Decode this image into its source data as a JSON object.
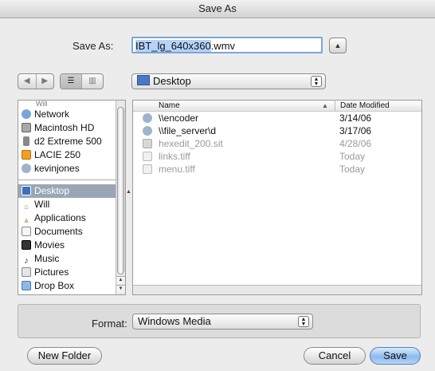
{
  "window": {
    "title": "Save As"
  },
  "save_as": {
    "label": "Save As:",
    "filename": "IBT_lg_640x360.wmv",
    "filename_selected": "IBT_lg_640x360",
    "filename_ext": ".wmv"
  },
  "nav": {
    "location": "Desktop"
  },
  "sidebar": {
    "partial_top": "Will",
    "devices": [
      {
        "label": "Network",
        "icon": "network-globe-icon"
      },
      {
        "label": "Macintosh HD",
        "icon": "hard-drive-icon"
      },
      {
        "label": "d2 Extreme 500",
        "icon": "external-drive-icon"
      },
      {
        "label": "LACIE 250",
        "icon": "external-drive-orange-icon"
      },
      {
        "label": "kevinjones",
        "icon": "network-share-icon"
      }
    ],
    "places": [
      {
        "label": "Desktop",
        "icon": "desktop-icon",
        "selected": true
      },
      {
        "label": "Will",
        "icon": "home-icon"
      },
      {
        "label": "Applications",
        "icon": "applications-icon"
      },
      {
        "label": "Documents",
        "icon": "documents-icon"
      },
      {
        "label": "Movies",
        "icon": "movies-icon"
      },
      {
        "label": "Music",
        "icon": "music-icon"
      },
      {
        "label": "Pictures",
        "icon": "pictures-icon"
      },
      {
        "label": "Drop Box",
        "icon": "dropbox-folder-icon"
      }
    ]
  },
  "file_list": {
    "columns": {
      "name": "Name",
      "date": "Date Modified"
    },
    "rows": [
      {
        "name": "\\\\encoder",
        "date": "3/14/06",
        "icon": "network-share-icon",
        "enabled": true
      },
      {
        "name": "\\\\file_server\\d",
        "date": "3/17/06",
        "icon": "network-share-icon",
        "enabled": true
      },
      {
        "name": "hexedit_200.sit",
        "date": "4/28/06",
        "icon": "archive-icon",
        "enabled": false
      },
      {
        "name": "links.tiff",
        "date": "Today",
        "icon": "tiff-file-icon",
        "enabled": false
      },
      {
        "name": "menu.tiff",
        "date": "Today",
        "icon": "tiff-file-icon",
        "enabled": false
      }
    ]
  },
  "format": {
    "label": "Format:",
    "value": "Windows Media"
  },
  "buttons": {
    "new_folder": "New Folder",
    "cancel": "Cancel",
    "save": "Save"
  }
}
